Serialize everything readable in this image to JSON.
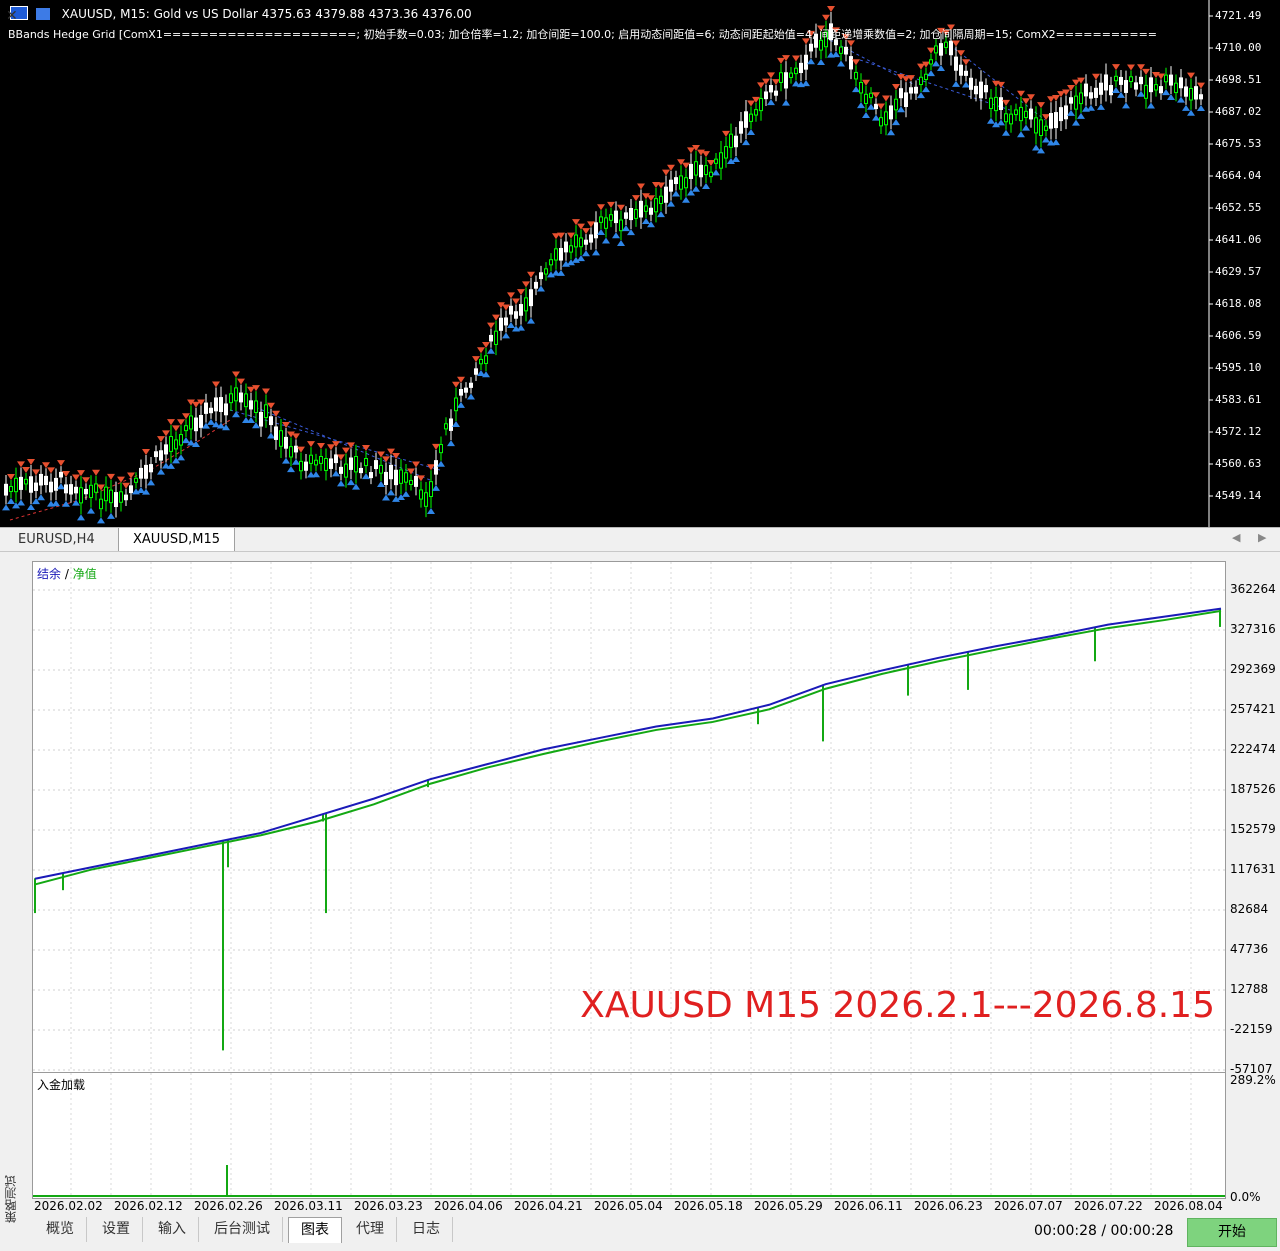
{
  "chart": {
    "header": "XAUUSD, M15:  Gold vs US Dollar  4375.63 4379.88 4373.36 4376.00",
    "subheader": "BBands Hedge Grid [ComX1=====================; 初始手数=0.03; 加仓倍率=1.2; 加仓间距=100.0; 启用动态间距值=6; 动态间距起始值=4; 间距递增乘数值=2; 加仓间隔周期=15; ComX2===========",
    "price_labels": [
      "4721.49",
      "4710.00",
      "4698.51",
      "4687.02",
      "4675.53",
      "4664.04",
      "4652.55",
      "4641.06",
      "4629.57",
      "4618.08",
      "4606.59",
      "4595.10",
      "4583.61",
      "4572.12",
      "4560.63",
      "4549.14"
    ],
    "colors": {
      "bg": "#000000",
      "up_candle": "#00ff00",
      "down_candle": "#ffffff",
      "sell_arrow": "#e8502f",
      "buy_arrow": "#2f86e8",
      "grid_line": "#3a5bd8"
    }
  },
  "tabs": [
    {
      "label": "EURUSD,H4",
      "active": false
    },
    {
      "label": "XAUUSD,M15",
      "active": true
    }
  ],
  "tester": {
    "legend": {
      "balance": "结余",
      "separator": "/",
      "equity": "净值"
    },
    "y_labels": [
      "362264",
      "327316",
      "292369",
      "257421",
      "222474",
      "187526",
      "152579",
      "117631",
      "82684",
      "47736",
      "12788",
      "-22159",
      "-57107"
    ],
    "annotation": "XAUUSD M15 2026.2.1---2026.8.15",
    "deposit_title": "入金加载",
    "deposit_y_labels": [
      "289.2%",
      "0.0%"
    ],
    "x_labels": [
      "2026.02.02",
      "2026.02.12",
      "2026.02.26",
      "2026.03.11",
      "2026.03.23",
      "2026.04.06",
      "2026.04.21",
      "2026.05.04",
      "2026.05.18",
      "2026.05.29",
      "2026.06.11",
      "2026.06.23",
      "2026.07.07",
      "2026.07.22",
      "2026.08.04"
    ],
    "vertical_label": "策略测试",
    "bottom_tabs": [
      "概览",
      "设置",
      "输入",
      "后台测试",
      "图表",
      "代理",
      "日志"
    ],
    "active_bottom_tab": "图表",
    "timer": "00:00:28 / 00:00:28",
    "start_label": "开始",
    "colors": {
      "balance": "#1a1ab8",
      "equity": "#13a813",
      "annotation": "#e02020",
      "start": "#7ed37e"
    }
  },
  "chart_data": [
    {
      "type": "line",
      "title": "",
      "series": [
        {
          "name": "结余",
          "values": [
            110000,
            120000,
            130000,
            140000,
            150000,
            165000,
            180000,
            197000,
            210000,
            223000,
            233000,
            243000,
            250000,
            262000,
            280000,
            292000,
            303000,
            313000,
            322000,
            332000,
            339000,
            346000
          ]
        },
        {
          "name": "净值",
          "values": [
            105000,
            118000,
            128000,
            138000,
            148000,
            160000,
            175000,
            193000,
            207000,
            219000,
            230000,
            240000,
            247000,
            258000,
            276000,
            289000,
            300000,
            310000,
            320000,
            329000,
            336000,
            344000
          ]
        }
      ],
      "x": [
        "2026.02.02",
        "2026.02.12",
        "2026.02.26",
        "2026.03.11",
        "2026.03.23",
        "2026.04.06",
        "2026.04.21",
        "2026.05.04",
        "2026.05.18",
        "2026.05.29",
        "2026.06.11",
        "2026.06.23",
        "2026.07.07",
        "2026.07.22",
        "2026.08.04"
      ],
      "ylim": [
        -57107,
        362264
      ],
      "grid": true
    },
    {
      "type": "bar",
      "title": "入金加载",
      "ylim": [
        0,
        289.2
      ]
    }
  ]
}
